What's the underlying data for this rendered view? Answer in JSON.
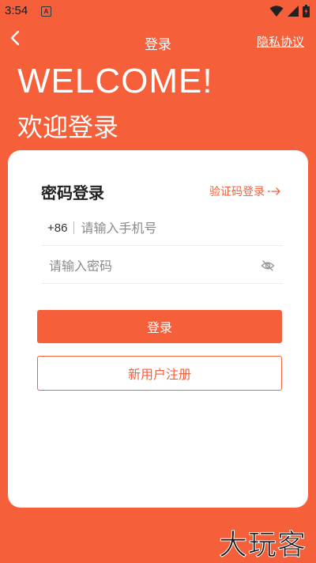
{
  "status_bar": {
    "time": "3:54",
    "notification_letter": "A"
  },
  "header": {
    "title": "登录",
    "privacy_link": "隐私协议"
  },
  "hero": {
    "welcome": "WELCOME!",
    "subtitle": "欢迎登录"
  },
  "login_card": {
    "title": "密码登录",
    "sms_login_label": "验证码登录",
    "phone": {
      "country_code": "+86",
      "placeholder": "请输入手机号",
      "value": ""
    },
    "password": {
      "placeholder": "请输入密码",
      "value": ""
    },
    "login_button": "登录",
    "register_button": "新用户注册"
  },
  "watermark": "大玩客",
  "colors": {
    "accent": "#F55F3A",
    "card": "#FFFFFF"
  }
}
